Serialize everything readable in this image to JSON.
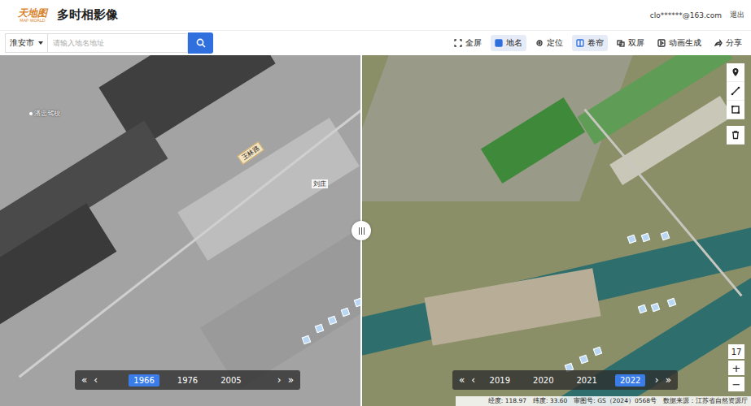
{
  "header": {
    "logo": {
      "main": "天地图",
      "sub": "MAP WORLD"
    },
    "title": "多时相影像",
    "user": "clo******@163.com",
    "logout": "退出"
  },
  "toolbar": {
    "city": "淮安市",
    "search_placeholder": "请输入地名地址",
    "tools": [
      {
        "label": "全屏",
        "selected": false
      },
      {
        "label": "地名",
        "selected": true
      },
      {
        "label": "定位",
        "selected": false
      },
      {
        "label": "卷帘",
        "selected": true
      },
      {
        "label": "双屏",
        "selected": false
      },
      {
        "label": "动画生成",
        "selected": false
      },
      {
        "label": "分享",
        "selected": false
      }
    ]
  },
  "map": {
    "left_labels": [
      {
        "text": "潘忠驾校",
        "kind": "poi"
      },
      {
        "text": "王林路",
        "kind": "road"
      },
      {
        "text": "刘庄",
        "kind": "place"
      }
    ]
  },
  "timelines": [
    {
      "first": "«",
      "prev": "‹",
      "next": "›",
      "last": "»",
      "years": [
        {
          "label": "1966",
          "selected": true
        },
        {
          "label": "1976",
          "selected": false
        },
        {
          "label": "2005",
          "selected": false
        }
      ]
    },
    {
      "first": "«",
      "prev": "‹",
      "next": "›",
      "last": "»",
      "years": [
        {
          "label": "2019",
          "selected": false
        },
        {
          "label": "2020",
          "selected": false
        },
        {
          "label": "2021",
          "selected": false
        },
        {
          "label": "2022",
          "selected": true
        }
      ]
    }
  ],
  "zoom": {
    "level": "17",
    "in": "+",
    "out": "−"
  },
  "status_bar": [
    "经度: 118.97",
    "纬度: 33.60",
    "审图号: GS（2024）0568号",
    "数据来源：江苏省自然资源厅"
  ]
}
